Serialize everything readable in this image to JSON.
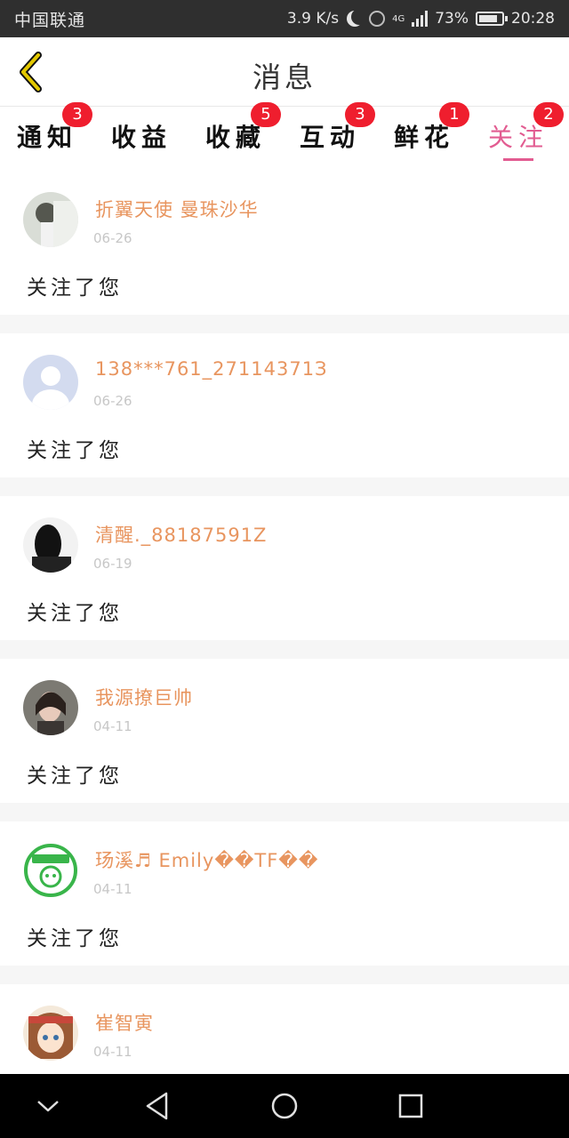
{
  "status_bar": {
    "carrier": "中国联通",
    "speed": "3.9 K/s",
    "network": "4G",
    "battery": "73%",
    "battery_level": 0.73,
    "time": "20:28"
  },
  "header": {
    "title": "消息"
  },
  "tabs": [
    {
      "label": "通知",
      "badge": "3"
    },
    {
      "label": "收益",
      "badge": ""
    },
    {
      "label": "收藏",
      "badge": "5"
    },
    {
      "label": "互动",
      "badge": "3"
    },
    {
      "label": "鲜花",
      "badge": "1"
    },
    {
      "label": "关注",
      "badge": "2",
      "active": true
    }
  ],
  "follows": [
    {
      "name": "折翼天使 曼珠沙华",
      "date": "06-26",
      "message": "关注了您"
    },
    {
      "name": "138***761_27114371З",
      "date": "06-26",
      "message": "关注了您"
    },
    {
      "name": "清醒._88187591Z",
      "date": "06-19",
      "message": "关注了您"
    },
    {
      "name": "我源撩巨帅",
      "date": "04-11",
      "message": "关注了您"
    },
    {
      "name": "玚溪♬ Emily��TF��",
      "date": "04-11",
      "message": "关注了您"
    },
    {
      "name": "崔智寅",
      "date": "04-11",
      "message": ""
    }
  ],
  "colors": {
    "accent": "#e25c91",
    "name": "#e8955f",
    "badge": "#ef1e2e",
    "back_icon": "#e3c800"
  },
  "icons": {
    "back": "chevron-left-icon",
    "nav_back": "triangle-back-icon",
    "nav_home": "circle-home-icon",
    "nav_recent": "square-recent-icon",
    "nav_hide": "chevron-down-icon"
  }
}
